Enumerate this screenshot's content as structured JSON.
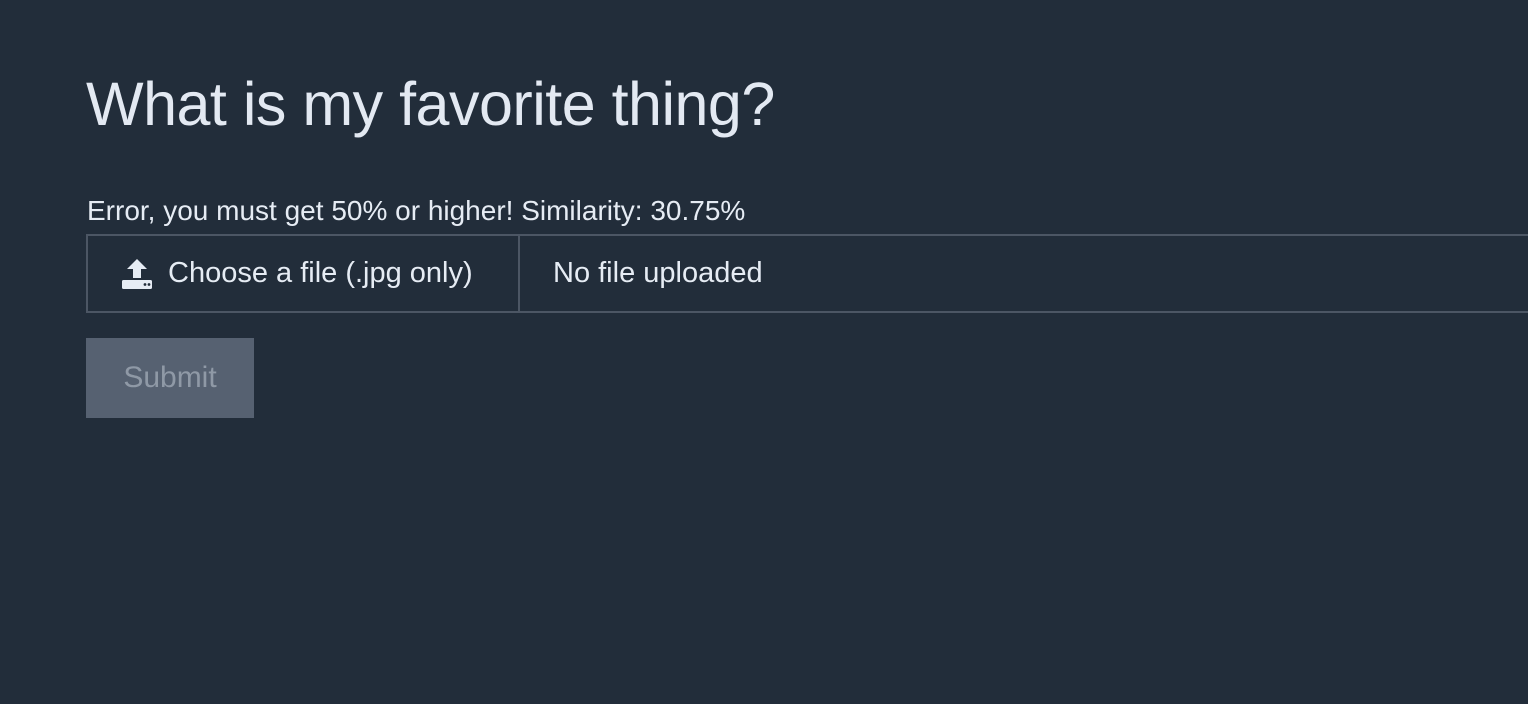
{
  "page": {
    "title": "What is my favorite thing?",
    "message": "Error, you must get 50% or higher! Similarity: 30.75%"
  },
  "file_input": {
    "icon": "upload-icon",
    "choose_label": "Choose a file (.jpg only)",
    "filename": "No file uploaded"
  },
  "form": {
    "submit_label": "Submit",
    "submit_disabled": true
  },
  "colors": {
    "background": "#222d3a",
    "text": "#e6ecf4",
    "border": "#4c5664",
    "button_disabled_bg": "#566171",
    "button_disabled_text": "#8f99a6"
  }
}
